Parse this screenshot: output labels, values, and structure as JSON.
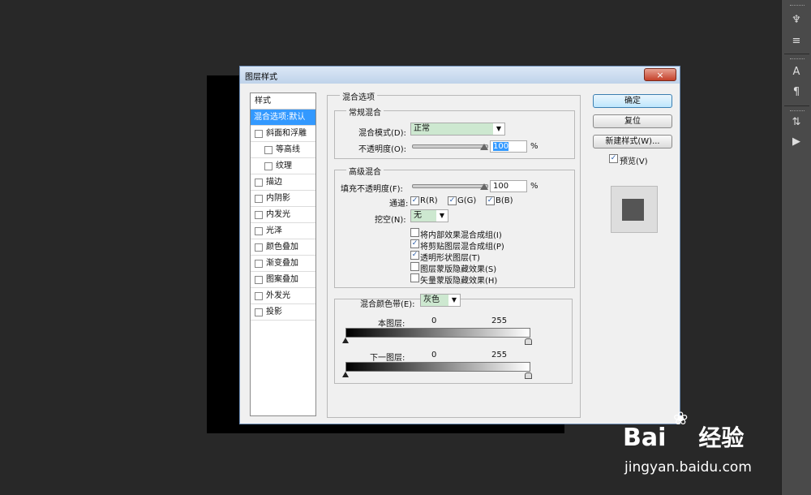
{
  "dialog": {
    "title": "图层样式",
    "close_glyph": "×"
  },
  "styles_list": {
    "header": "样式",
    "items": [
      {
        "label": "混合选项:默认",
        "selected": true,
        "indent": 0
      },
      {
        "label": "斜面和浮雕",
        "indent": 0
      },
      {
        "label": "等高线",
        "indent": 1
      },
      {
        "label": "纹理",
        "indent": 1
      },
      {
        "label": "描边",
        "indent": 0
      },
      {
        "label": "内阴影",
        "indent": 0
      },
      {
        "label": "内发光",
        "indent": 0
      },
      {
        "label": "光泽",
        "indent": 0
      },
      {
        "label": "颜色叠加",
        "indent": 0
      },
      {
        "label": "渐变叠加",
        "indent": 0
      },
      {
        "label": "图案叠加",
        "indent": 0
      },
      {
        "label": "外发光",
        "indent": 0
      },
      {
        "label": "投影",
        "indent": 0
      }
    ]
  },
  "blend_options": {
    "title": "混合选项",
    "general": {
      "title": "常规混合",
      "mode_label": "混合模式(D):",
      "mode_value": "正常",
      "opacity_label": "不透明度(O):",
      "opacity_value": "100",
      "opacity_unit": "%",
      "opacity_level": 1.0
    },
    "advanced": {
      "title": "高级混合",
      "fill_label": "填充不透明度(F):",
      "fill_value": "100",
      "fill_unit": "%",
      "fill_level": 1.0,
      "channels_label": "通道:",
      "channel_r": "R(R)",
      "channel_g": "G(G)",
      "channel_b": "B(B)",
      "knockout_label": "挖空(N):",
      "knockout_value": "无",
      "options": [
        {
          "label": "将内部效果混合成组(I)",
          "checked": false
        },
        {
          "label": "将剪贴图层混合成组(P)",
          "checked": true
        },
        {
          "label": "透明形状图层(T)",
          "checked": true
        },
        {
          "label": "图层蒙版隐藏效果(S)",
          "checked": false
        },
        {
          "label": "矢量蒙版隐藏效果(H)",
          "checked": false
        }
      ]
    },
    "blend_if": {
      "label": "混合颜色带(E):",
      "value": "灰色",
      "this_layer": {
        "label": "本图层:",
        "min": "0",
        "max": "255"
      },
      "under_layer": {
        "label": "下一图层:",
        "min": "0",
        "max": "255"
      }
    }
  },
  "buttons": {
    "ok": "确定",
    "reset": "复位",
    "new_style": "新建样式(W)...",
    "preview": "预览(V)"
  },
  "watermark": {
    "brand": "Bai",
    "brand_cn": "经验",
    "url": "jingyan.baidu.com"
  },
  "colors": {
    "selection": "#3399ff",
    "select_bg": "#cde8d0",
    "background": "#282828"
  }
}
